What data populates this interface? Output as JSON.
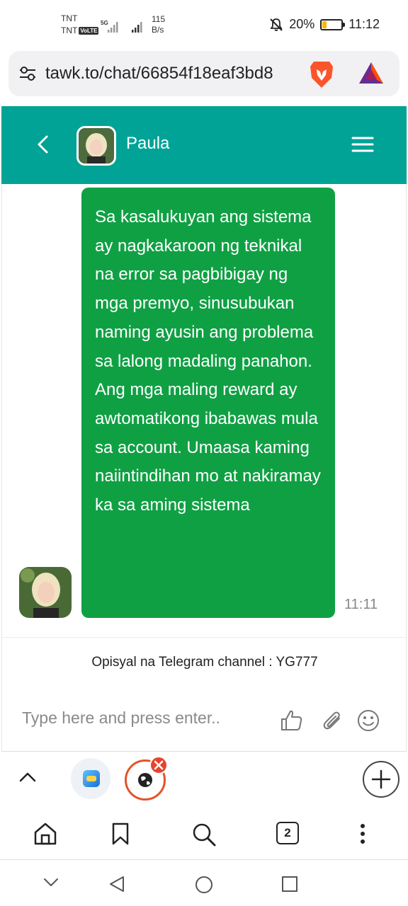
{
  "status_bar": {
    "carrier_top": "TNT",
    "carrier_bottom": "TNT",
    "volte": "VoLTE",
    "signal_type": "5G",
    "net_speed_value": "115",
    "net_speed_unit": "B/s",
    "battery_percent": "20%",
    "battery_level": 0.2,
    "time": "11:12"
  },
  "browser": {
    "url": "tawk.to/chat/66854f18eaf3bd8",
    "icons": [
      "tune-icon",
      "brave-lion-icon",
      "bat-rewards-icon"
    ]
  },
  "chat": {
    "header": {
      "agent_name": "Paula"
    },
    "message": {
      "text": "Sa kasalukuyan ang sistema ay nagkakaroon ng teknikal na error sa pagbibigay ng mga premyo, sinusubukan naming ayusin ang problema sa lalong madaling panahon. Ang mga maling reward ay awtomatikong ibabawas mula sa account. Umaasa kaming naiintindihan mo at nakiramay ka sa aming sistema",
      "time": "11:11"
    },
    "footer_note": "Opisyal na Telegram channel : YG777",
    "input_placeholder": "Type here and press enter..",
    "colors": {
      "header": "#00a396",
      "bubble": "#10a044"
    }
  },
  "tabs": {
    "open_count": "2"
  }
}
